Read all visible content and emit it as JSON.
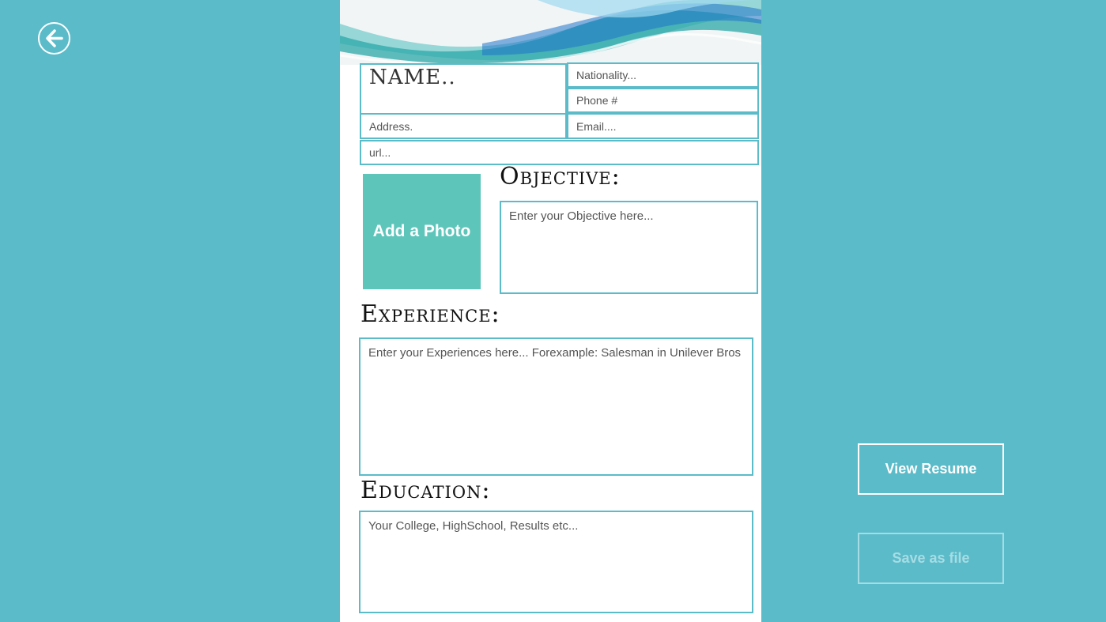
{
  "app": {
    "back_icon": "arrow-left-circle-icon",
    "colors": {
      "background": "#5bbbc9",
      "accent": "#5bbbc9",
      "photo_tile": "#5ec5bb",
      "disabled": "#a6dde5"
    }
  },
  "form": {
    "name_placeholder": "NAME..",
    "nationality_placeholder": "Nationality...",
    "phone_placeholder": "Phone #",
    "address_placeholder": "Address.",
    "email_placeholder": "Email....",
    "url_placeholder": "url...",
    "photo_label": "Add a Photo",
    "objective_title": "Objective:",
    "objective_placeholder": "Enter your Objective here...",
    "experience_title": "Experience:",
    "experience_placeholder": "Enter your Experiences here... Forexample: Salesman in Unilever Bros",
    "education_title": "Education:",
    "education_placeholder": "Your College, HighSchool, Results etc..."
  },
  "actions": {
    "view_resume": "View Resume",
    "save_as_file": "Save as file"
  }
}
